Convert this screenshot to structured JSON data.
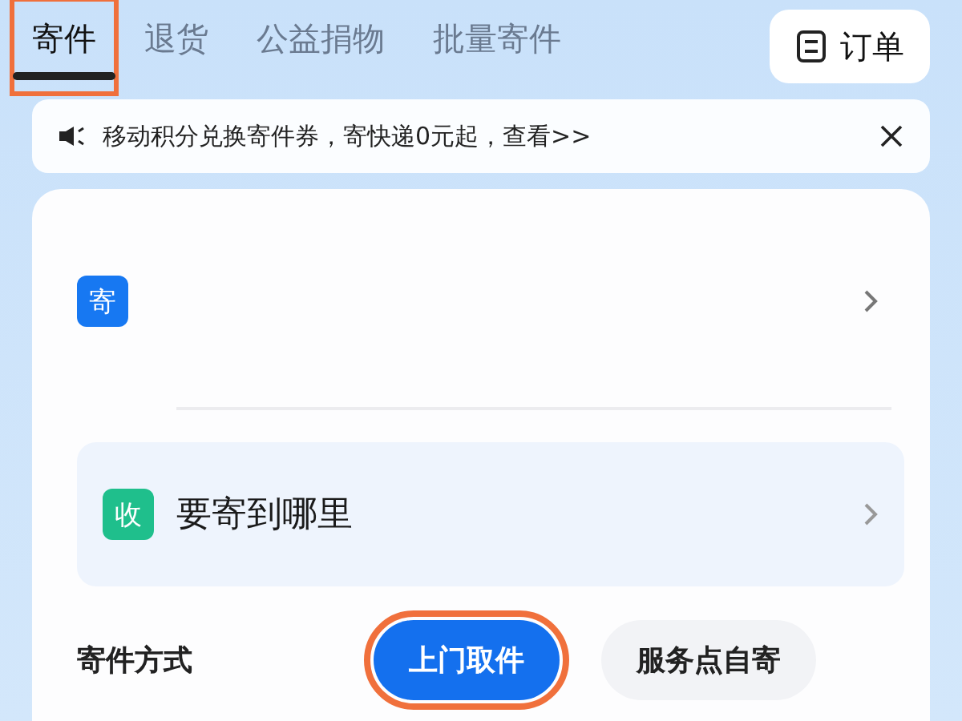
{
  "tabs": [
    {
      "label": "寄件",
      "selected": true,
      "highlighted": true
    },
    {
      "label": "退货",
      "selected": false,
      "highlighted": false
    },
    {
      "label": "公益捐物",
      "selected": false,
      "highlighted": false
    },
    {
      "label": "批量寄件",
      "selected": false,
      "highlighted": false
    }
  ],
  "orders_button": {
    "label": "订单"
  },
  "notice": {
    "text": "移动积分兑换寄件券，寄快递0元起，查看>>"
  },
  "sender": {
    "badge": "寄"
  },
  "receiver": {
    "badge": "收",
    "prompt": "要寄到哪里"
  },
  "shipping_method": {
    "label": "寄件方式",
    "options": [
      {
        "label": "上门取件",
        "selected": true,
        "highlighted": true
      },
      {
        "label": "服务点自寄",
        "selected": false,
        "highlighted": false
      }
    ]
  }
}
